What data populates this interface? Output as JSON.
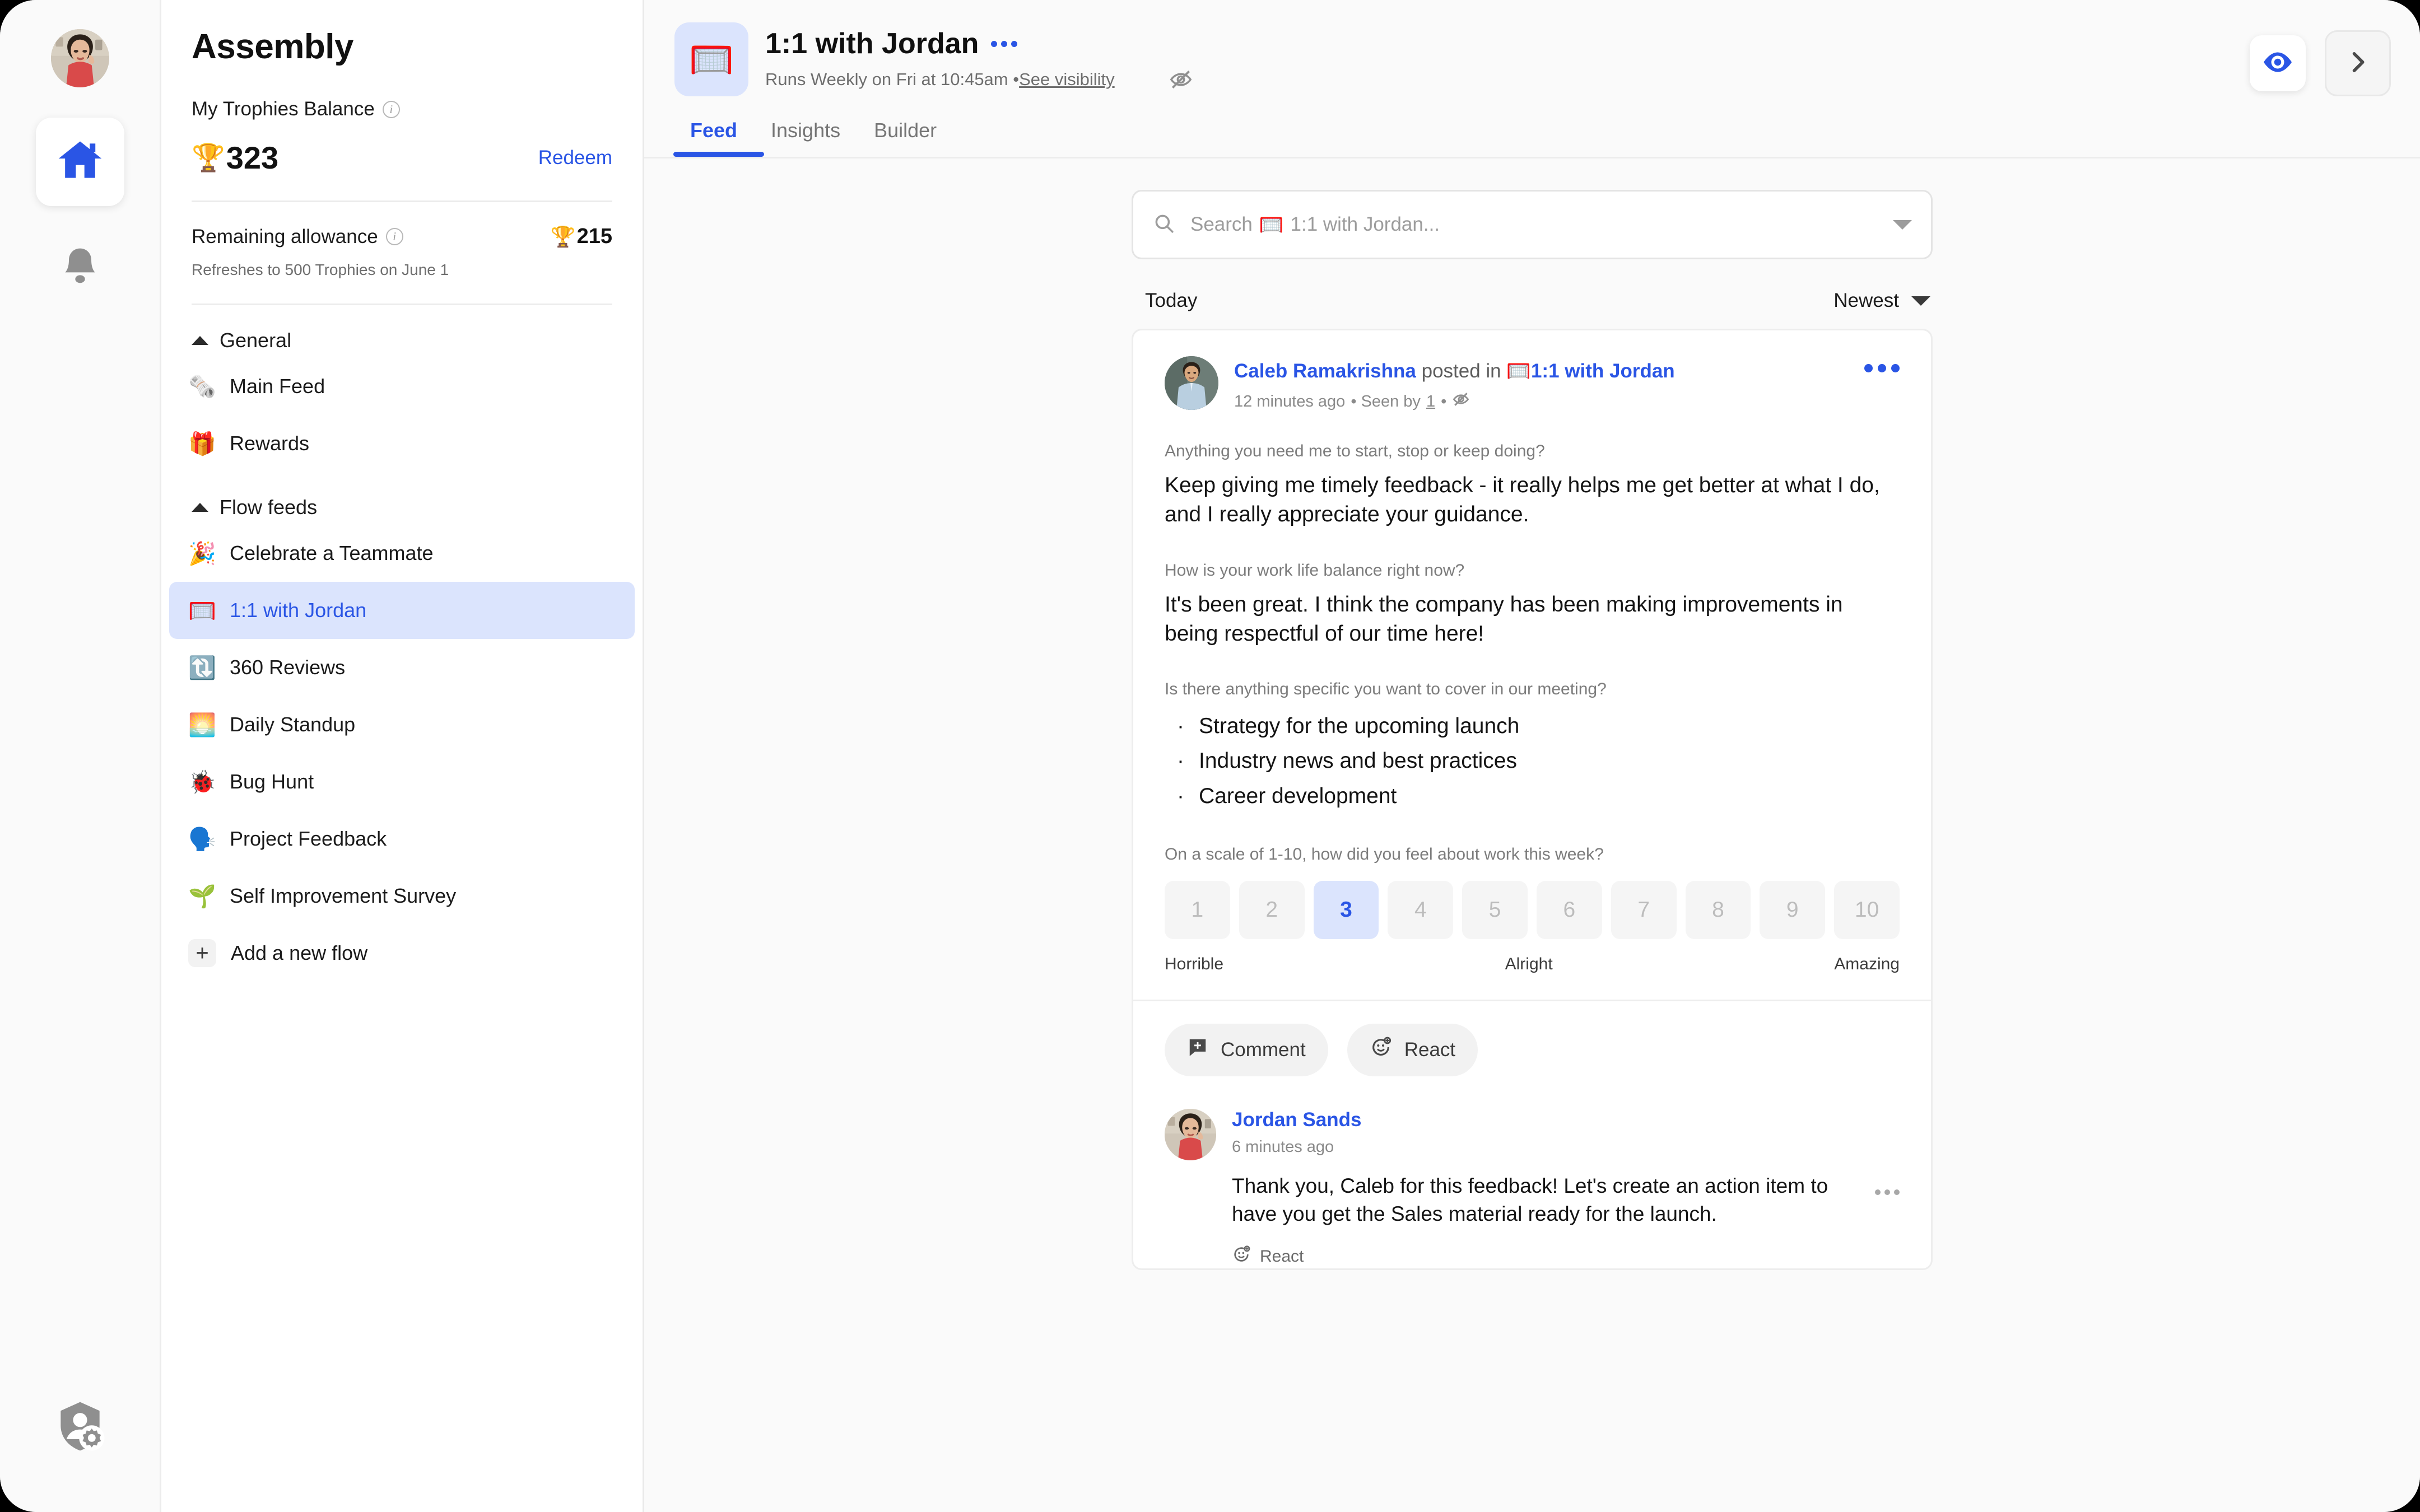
{
  "rail": {
    "avatar_name": "user-avatar",
    "home_label": "Home",
    "notifications_label": "Notifications",
    "admin_label": "Admin settings"
  },
  "panel": {
    "brand": "Assembly",
    "balance_label": "My Trophies Balance",
    "balance_value": "323",
    "balance_trophy": "🏆",
    "redeem_label": "Redeem",
    "allowance_label": "Remaining allowance",
    "allowance_value": "215",
    "allowance_trophy": "🏆",
    "allowance_sub": "Refreshes to 500 Trophies on June 1",
    "groups": [
      {
        "title": "General",
        "items": [
          {
            "emoji": "🗞️",
            "label": "Main Feed",
            "active": false
          },
          {
            "emoji": "🎁",
            "label": "Rewards",
            "active": false
          }
        ]
      },
      {
        "title": "Flow feeds",
        "items": [
          {
            "emoji": "🎉",
            "label": "Celebrate a Teammate",
            "active": false
          },
          {
            "emoji": "🥅",
            "label": "1:1 with Jordan",
            "active": true
          },
          {
            "emoji": "🔃",
            "label": "360 Reviews",
            "active": false
          },
          {
            "emoji": "🌅",
            "label": "Daily Standup",
            "active": false
          },
          {
            "emoji": "🐞",
            "label": "Bug Hunt",
            "active": false
          },
          {
            "emoji": "🗣️",
            "label": "Project Feedback",
            "active": false
          },
          {
            "emoji": "🌱",
            "label": "Self Improvement Survey",
            "active": false
          }
        ]
      }
    ],
    "add_flow_label": "Add a new flow"
  },
  "header": {
    "flow_emoji": "🥅",
    "title": "1:1 with Jordan",
    "schedule": "Runs Weekly on Fri at 10:45am • ",
    "visibility_link": "See visibility",
    "tabs": [
      {
        "label": "Feed",
        "active": true
      },
      {
        "label": "Insights",
        "active": false
      },
      {
        "label": "Builder",
        "active": false
      }
    ]
  },
  "search": {
    "placeholder_prefix": "Search ",
    "placeholder_emoji": "🥅",
    "placeholder_suffix": "1:1 with Jordan..."
  },
  "feed": {
    "date_group": "Today",
    "sort_label": "Newest"
  },
  "post": {
    "author": "Caleb Ramakrishna",
    "posted_in_text": " posted in ",
    "flow_emoji": "🥅",
    "flow_name": "1:1 with Jordan",
    "time": "12 minutes ago",
    "seen_prefix": " • Seen by ",
    "seen_count": "1",
    "seen_suffix": " • ",
    "blocks": [
      {
        "type": "text",
        "question": "Anything you need me to start, stop or keep doing?",
        "answer": "Keep giving me timely feedback - it really helps me get better at what I do, and I really appreciate your guidance."
      },
      {
        "type": "text",
        "question": "How is your work life balance right now?",
        "answer": "It's been great. I think the company has been making improvements in being respectful of our time here!"
      },
      {
        "type": "list",
        "question": "Is there anything specific you want to cover in our meeting?",
        "items": [
          "Strategy for the upcoming launch",
          "Industry news and best practices",
          "Career development"
        ]
      }
    ],
    "scale": {
      "question": "On a scale of 1-10, how did you feel about work this week?",
      "options": [
        "1",
        "2",
        "3",
        "4",
        "5",
        "6",
        "7",
        "8",
        "9",
        "10"
      ],
      "selected": "3",
      "label_low": "Horrible",
      "label_mid": "Alright",
      "label_high": "Amazing"
    },
    "actions": {
      "comment_label": "Comment",
      "react_label": "React"
    }
  },
  "reply": {
    "author": "Jordan Sands",
    "time": "6 minutes ago",
    "text": "Thank you, Caleb for this feedback! Let's create an action item to have you get the Sales material ready for the launch.",
    "react_label": "React"
  },
  "colors": {
    "accent": "#2a55e5",
    "accent_soft": "#dbe4fd",
    "surface": "#ffffff",
    "background": "#fafafa",
    "muted_text": "#8a8a8a"
  }
}
